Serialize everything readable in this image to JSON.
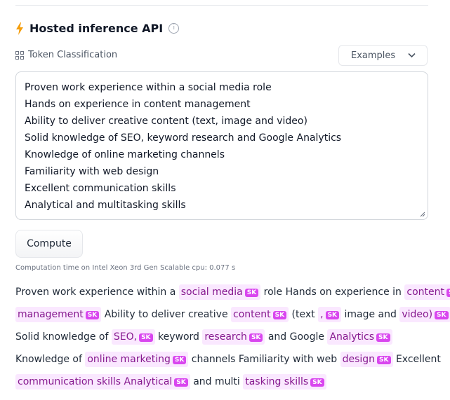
{
  "widget": {
    "title": "Hosted inference API",
    "info_symbol": "i",
    "task_label": "Token Classification",
    "examples_label": "Examples",
    "input_lines": [
      "Proven work experience within a social media role",
      "Hands on experience in content management",
      "Ability to deliver creative content (text, image and video)",
      "Solid knowledge of SEO, keyword research and Google Analytics",
      "Knowledge of online marketing channels",
      "Familiarity with web design",
      "Excellent communication skills",
      "Analytical and multitasking skills"
    ],
    "compute_label": "Compute",
    "timing_text": "Computation time on Intel Xeon 3rd Gen Scalable cpu: 0.077 s"
  },
  "output": {
    "tag": "SK",
    "rows": [
      [
        {
          "t": "Proven work experience within a "
        },
        {
          "e": "social media"
        },
        {
          "t": " role Hands on experience in "
        },
        {
          "e": "content"
        }
      ],
      [
        {
          "e": "management"
        },
        {
          "t": " Ability to deliver creative "
        },
        {
          "e": "content"
        },
        {
          "t": " (text "
        },
        {
          "e": ","
        },
        {
          "t": " image and "
        },
        {
          "e": "video)"
        }
      ],
      [
        {
          "t": "Solid knowledge of "
        },
        {
          "e": "SEO,"
        },
        {
          "t": " keyword "
        },
        {
          "e": "research"
        },
        {
          "t": " and Google "
        },
        {
          "e": "Analytics"
        }
      ],
      [
        {
          "t": "Knowledge of "
        },
        {
          "e": "online marketing"
        },
        {
          "t": " channels Familiarity with web "
        },
        {
          "e": "design"
        },
        {
          "t": " Excellent"
        }
      ],
      [
        {
          "e": "communication skills Analytical"
        },
        {
          "t": " and multi "
        },
        {
          "e": "tasking skills"
        }
      ]
    ]
  },
  "colors": {
    "accent": "#f59e0b",
    "entity_bg": "#fae8ff",
    "entity_text": "#86198f",
    "tag_bg": "#d946ef"
  },
  "icons": [
    "lightning-icon",
    "info-icon",
    "token-classification-icon",
    "chevron-down-icon",
    "resize-handle-icon"
  ]
}
